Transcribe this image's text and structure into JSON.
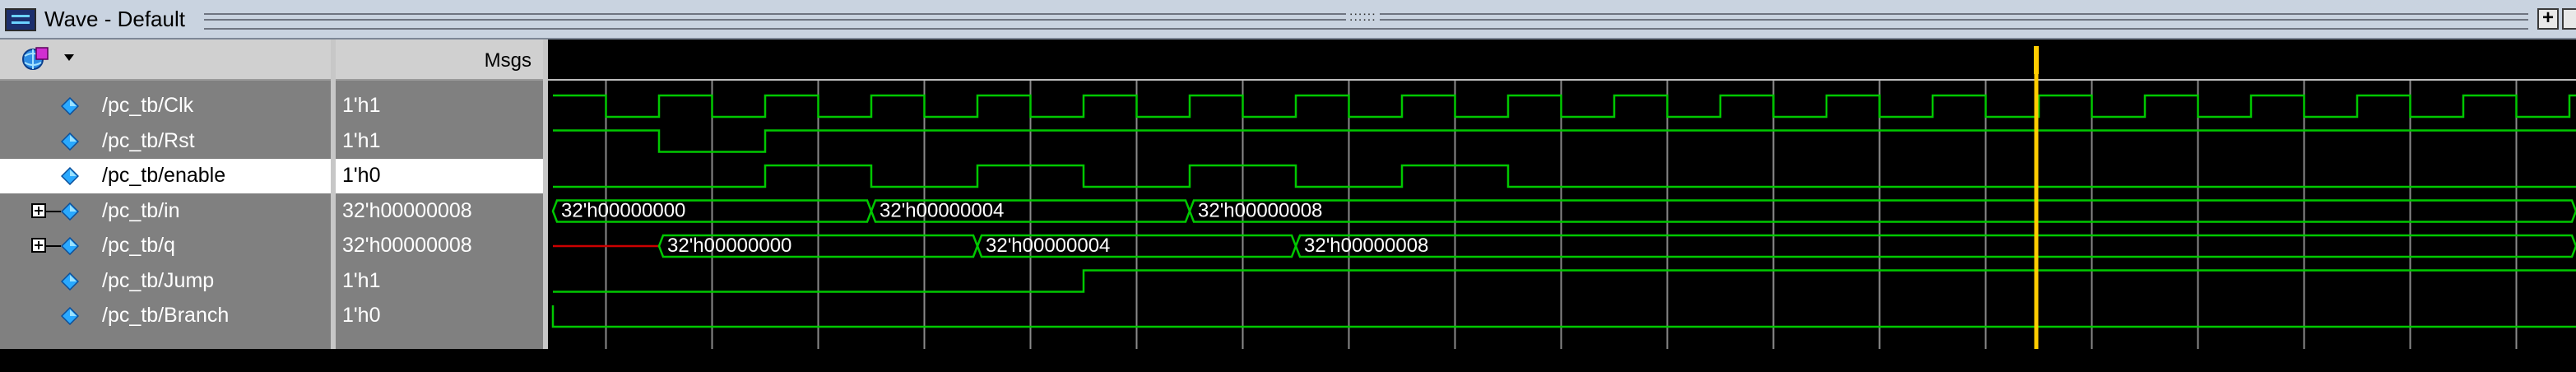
{
  "window": {
    "title": "Wave - Default",
    "grip": "::::::",
    "buttons": [
      {
        "icon": "plus-icon",
        "label": "+"
      }
    ]
  },
  "header": {
    "msgs_label": "Msgs",
    "add_icon": "globe-icon"
  },
  "signals": [
    {
      "name": "/pc_tb/Clk",
      "value": "1'h1",
      "expandable": false,
      "selected": false
    },
    {
      "name": "/pc_tb/Rst",
      "value": "1'h1",
      "expandable": false,
      "selected": false
    },
    {
      "name": "/pc_tb/enable",
      "value": "1'h0",
      "expandable": false,
      "selected": true
    },
    {
      "name": "/pc_tb/in",
      "value": "32'h00000008",
      "expandable": true,
      "selected": false
    },
    {
      "name": "/pc_tb/q",
      "value": "32'h00000008",
      "expandable": true,
      "selected": false
    },
    {
      "name": "/pc_tb/Jump",
      "value": "1'h1",
      "expandable": false,
      "selected": false
    },
    {
      "name": "/pc_tb/Branch",
      "value": "1'h0",
      "expandable": false,
      "selected": false
    }
  ],
  "waves": {
    "bus_in_labels": [
      "32'h00000000",
      "32'h00000004",
      "32'h00000008"
    ],
    "bus_q_labels": [
      "32'h00000000",
      "32'h00000004",
      "32'h00000008"
    ],
    "colors": {
      "wave": "#00c800",
      "grid": "#8a8a8a",
      "cursor": "#ffcc00",
      "undefined": "#cc0000",
      "bus_text": "#ffffff"
    }
  }
}
